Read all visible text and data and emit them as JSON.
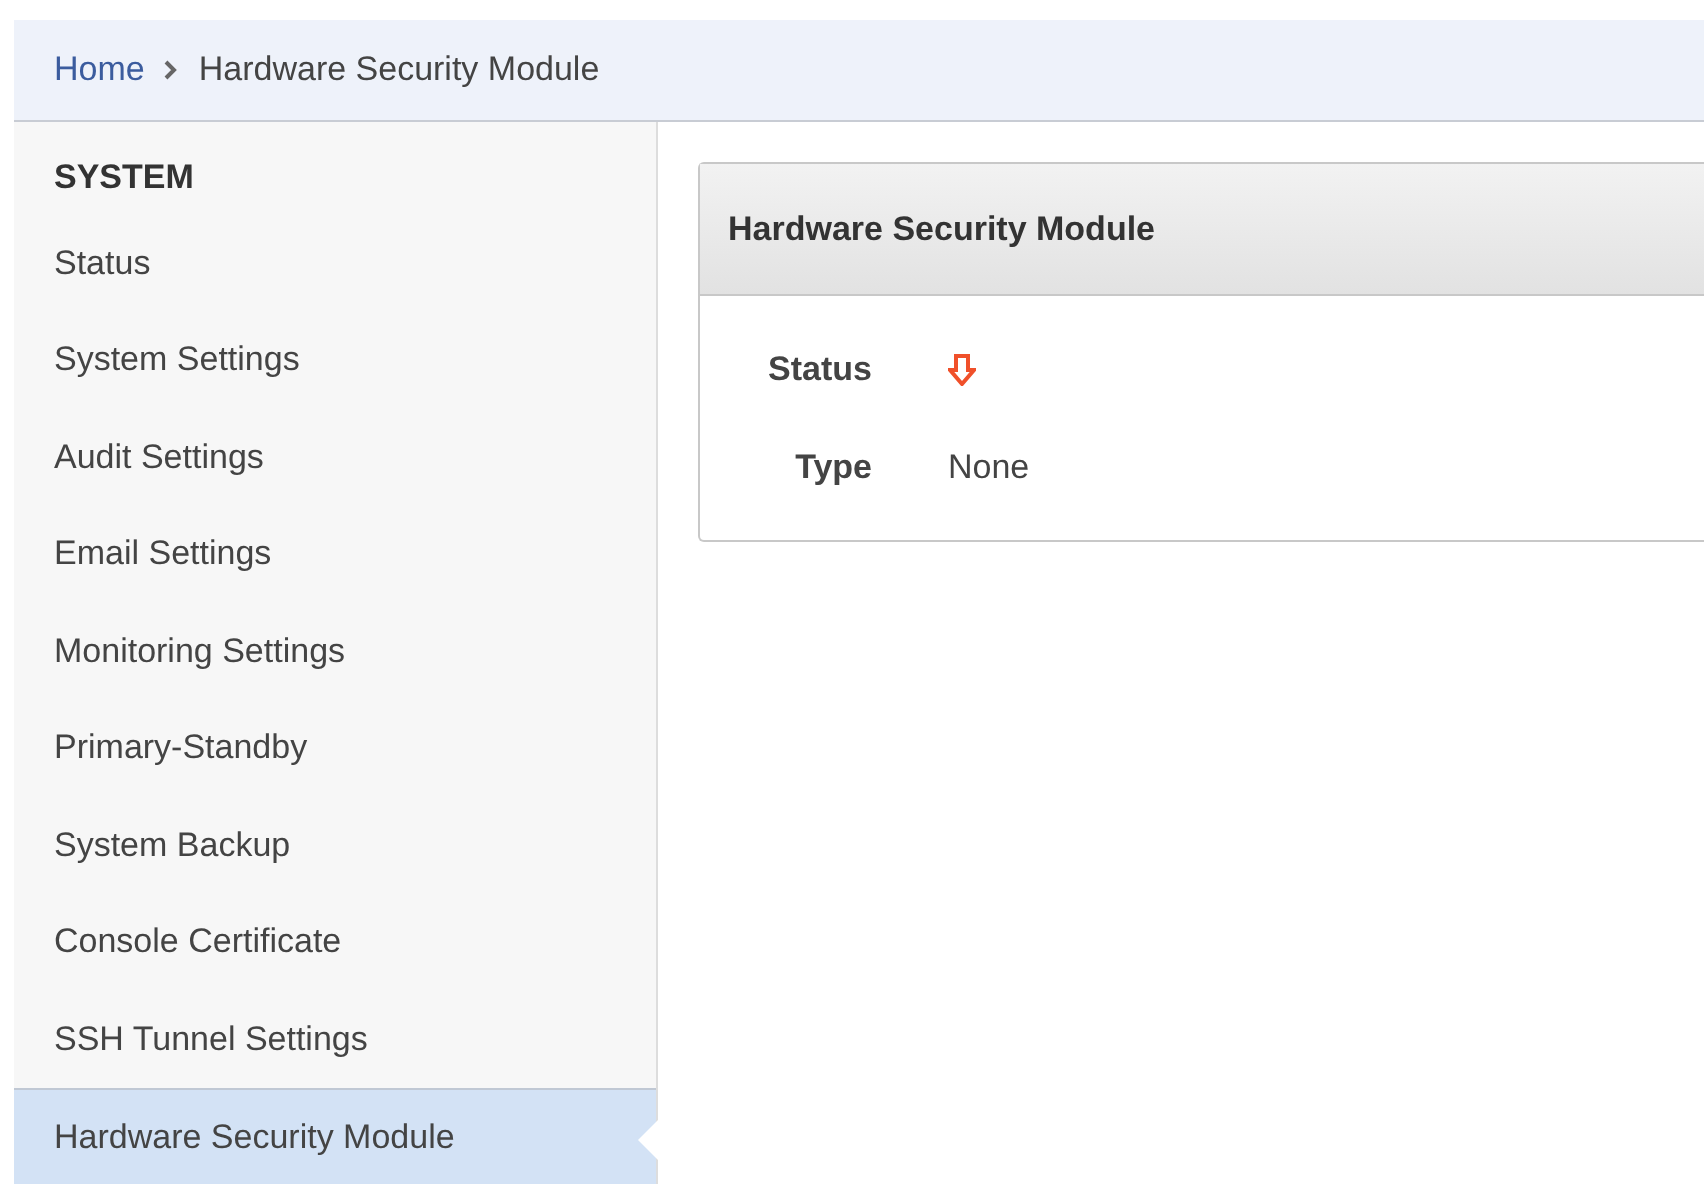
{
  "breadcrumb": [
    {
      "label": "Home",
      "link": true
    },
    {
      "label": "Hardware Security Module",
      "link": false
    }
  ],
  "sidebar": {
    "heading": "SYSTEM",
    "items": [
      {
        "label": "Status",
        "selected": false
      },
      {
        "label": "System Settings",
        "selected": false
      },
      {
        "label": "Audit Settings",
        "selected": false
      },
      {
        "label": "Email Settings",
        "selected": false
      },
      {
        "label": "Monitoring Settings",
        "selected": false
      },
      {
        "label": "Primary-Standby",
        "selected": false
      },
      {
        "label": "System Backup",
        "selected": false
      },
      {
        "label": "Console Certificate",
        "selected": false
      },
      {
        "label": "SSH Tunnel Settings",
        "selected": false
      },
      {
        "label": "Hardware Security Module",
        "selected": true
      }
    ]
  },
  "panel": {
    "title": "Hardware Security Module",
    "fields": [
      {
        "label": "Status",
        "kind": "status"
      },
      {
        "label": "Type",
        "kind": "text",
        "value": "None"
      }
    ]
  }
}
